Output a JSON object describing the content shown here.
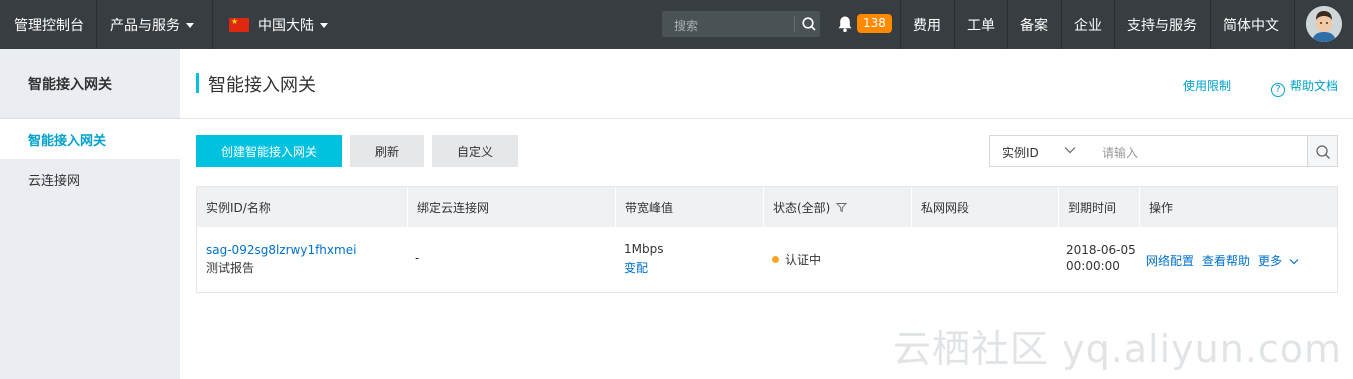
{
  "topbar": {
    "console": "管理控制台",
    "products": "产品与服务",
    "region": "中国大陆",
    "search_placeholder": "搜索",
    "notification_count": "138",
    "nav": [
      "费用",
      "工单",
      "备案",
      "企业",
      "支持与服务",
      "简体中文"
    ]
  },
  "sidebar": {
    "title": "智能接入网关",
    "items": [
      "智能接入网关",
      "云连接网"
    ]
  },
  "main": {
    "title": "智能接入网关",
    "usage_limit": "使用限制",
    "help_docs": "帮助文档",
    "buttons": {
      "create": "创建智能接入网关",
      "refresh": "刷新",
      "customize": "自定义"
    },
    "filter": {
      "field": "实例ID",
      "placeholder": "请输入"
    },
    "table": {
      "headers": [
        "实例ID/名称",
        "绑定云连接网",
        "带宽峰值",
        "状态(全部)",
        "私网网段",
        "到期时间",
        "操作"
      ],
      "rows": [
        {
          "id": "sag-092sg8lzrwy1fhxmei",
          "name": "测试报告",
          "ccn": "-",
          "bandwidth": "1Mbps",
          "bandwidth_action": "变配",
          "status": "认证中",
          "cidr": "",
          "expire_date": "2018-06-05",
          "expire_time": "00:00:00",
          "actions": [
            "网络配置",
            "查看帮助",
            "更多"
          ]
        }
      ]
    }
  },
  "watermark": "云栖社区 yq.aliyun.com",
  "colors": {
    "topbar": "#373d41",
    "accent": "#00c1de",
    "link": "#0070cc",
    "badge": "#ff8a00",
    "status_pending": "#f5a623"
  }
}
